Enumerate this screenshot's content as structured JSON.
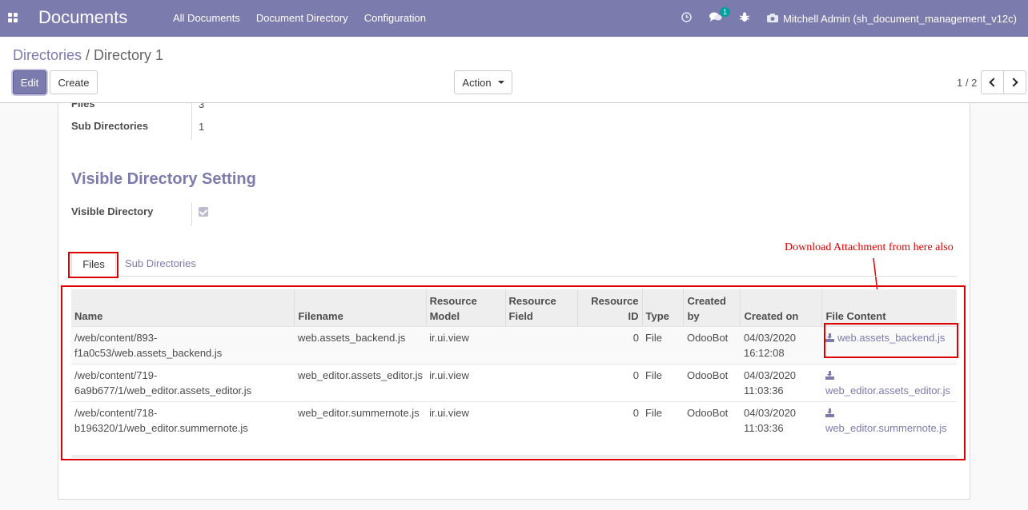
{
  "navbar": {
    "brand": "Documents",
    "menu": [
      "All Documents",
      "Document Directory",
      "Configuration"
    ],
    "messages_count": "1",
    "user": "Mitchell Admin (sh_document_management_v12c)"
  },
  "breadcrumb": {
    "parent": "Directories",
    "separator": "/",
    "current": "Directory 1"
  },
  "buttons": {
    "edit": "Edit",
    "create": "Create",
    "action": "Action"
  },
  "pager": {
    "value": "1 / 2"
  },
  "form": {
    "files_label": "Files",
    "files_value": "3",
    "subdirs_label": "Sub Directories",
    "subdirs_value": "1",
    "section_title": "Visible Directory Setting",
    "visible_label": "Visible Directory",
    "visible_checked": true
  },
  "tabs": [
    "Files",
    "Sub Directories"
  ],
  "annotation": "Download Attachment from here also",
  "table": {
    "headers": [
      "Name",
      "Filename",
      "Resource Model",
      "Resource Field",
      "Resource ID",
      "Type",
      "Created by",
      "Created on",
      "File Content"
    ],
    "rows": [
      {
        "name": "/web/content/893-f1a0c53/web.assets_backend.js",
        "filename": "web.assets_backend.js",
        "model": "ir.ui.view",
        "field": "",
        "res_id": "0",
        "type": "File",
        "created_by": "OdooBot",
        "created_on": "04/03/2020 16:12:08",
        "content": "web.assets_backend.js"
      },
      {
        "name": "/web/content/719-6a9b677/1/web_editor.assets_editor.js",
        "filename": "web_editor.assets_editor.js",
        "model": "ir.ui.view",
        "field": "",
        "res_id": "0",
        "type": "File",
        "created_by": "OdooBot",
        "created_on": "04/03/2020 11:03:36",
        "content": "web_editor.assets_editor.js"
      },
      {
        "name": "/web/content/718-b196320/1/web_editor.summernote.js",
        "filename": "web_editor.summernote.js",
        "model": "ir.ui.view",
        "field": "",
        "res_id": "0",
        "type": "File",
        "created_by": "OdooBot",
        "created_on": "04/03/2020 11:03:36",
        "content": "web_editor.summernote.js"
      }
    ]
  },
  "colors": {
    "primary": "#7c7bad",
    "annotation": "#dd0000"
  }
}
